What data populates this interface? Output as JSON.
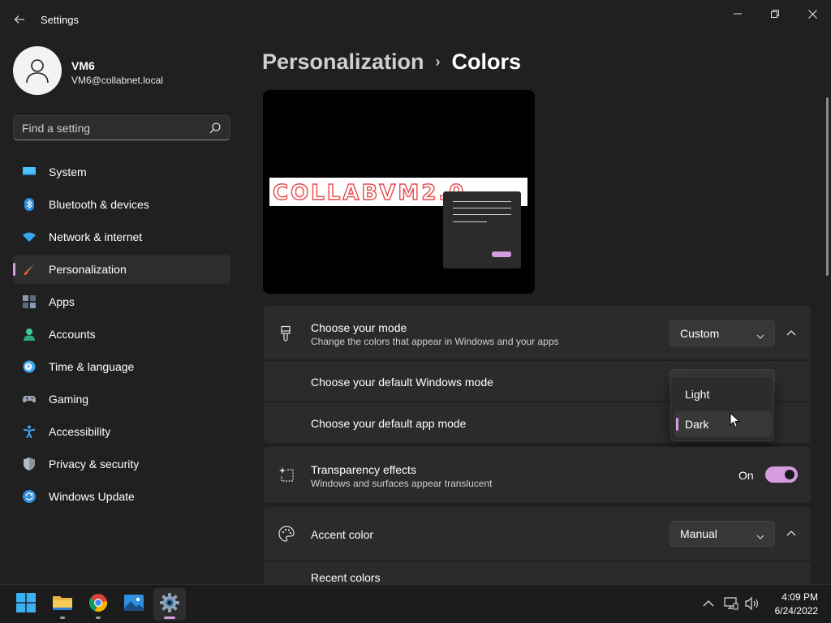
{
  "window": {
    "title": "Settings",
    "icons": {
      "back": "back-arrow-icon",
      "minimize": "minimize-icon",
      "maximize": "maximize-icon",
      "close": "close-icon"
    }
  },
  "profile": {
    "name": "VM6",
    "email": "VM6@collabnet.local",
    "avatar_icon": "user-avatar-icon"
  },
  "search": {
    "placeholder": "Find a setting",
    "value": "",
    "icon": "search-icon"
  },
  "sidebar": {
    "items": [
      {
        "label": "System",
        "icon": "system-monitor-icon",
        "active": false
      },
      {
        "label": "Bluetooth & devices",
        "icon": "bluetooth-icon",
        "active": false
      },
      {
        "label": "Network & internet",
        "icon": "wifi-icon",
        "active": false
      },
      {
        "label": "Personalization",
        "icon": "paintbrush-icon",
        "active": true
      },
      {
        "label": "Apps",
        "icon": "apps-icon",
        "active": false
      },
      {
        "label": "Accounts",
        "icon": "account-person-icon",
        "active": false
      },
      {
        "label": "Time & language",
        "icon": "clock-globe-icon",
        "active": false
      },
      {
        "label": "Gaming",
        "icon": "gamepad-icon",
        "active": false
      },
      {
        "label": "Accessibility",
        "icon": "accessibility-icon",
        "active": false
      },
      {
        "label": "Privacy & security",
        "icon": "shield-icon",
        "active": false
      },
      {
        "label": "Windows Update",
        "icon": "windows-update-icon",
        "active": false
      }
    ]
  },
  "breadcrumb": {
    "parent": "Personalization",
    "separator": "›",
    "current": "Colors"
  },
  "preview": {
    "banner_text": "COLLABVM2.0"
  },
  "mode_card": {
    "title": "Choose your mode",
    "subtitle": "Change the colors that appear in Windows and your apps",
    "dropdown_value": "Custom",
    "icon": "paint-mode-icon",
    "rows": [
      {
        "label": "Choose your default Windows mode"
      },
      {
        "label": "Choose your default app mode"
      }
    ]
  },
  "mode_popup": {
    "options": [
      {
        "label": "Light",
        "selected": false
      },
      {
        "label": "Dark",
        "selected": true
      }
    ]
  },
  "transparency_card": {
    "title": "Transparency effects",
    "subtitle": "Windows and surfaces appear translucent",
    "toggle_label": "On",
    "toggle_on": true,
    "icon": "sparkle-window-icon"
  },
  "accent_card": {
    "title": "Accent color",
    "dropdown_value": "Manual",
    "icon": "palette-icon",
    "recent_colors_label": "Recent colors"
  },
  "taskbar": {
    "apps": [
      {
        "name": "start",
        "icon": "windows-start-icon",
        "active": false
      },
      {
        "name": "file-explorer",
        "icon": "folder-icon",
        "active": false
      },
      {
        "name": "chrome",
        "icon": "chrome-icon",
        "active": false
      },
      {
        "name": "photos",
        "icon": "photos-icon",
        "active": false
      },
      {
        "name": "settings",
        "icon": "gear-icon",
        "active": true
      }
    ],
    "tray": {
      "time": "4:09 PM",
      "date": "6/24/2022"
    }
  },
  "colors": {
    "accent": "#d59de0",
    "background": "#202020",
    "card": "#2b2b2b"
  }
}
